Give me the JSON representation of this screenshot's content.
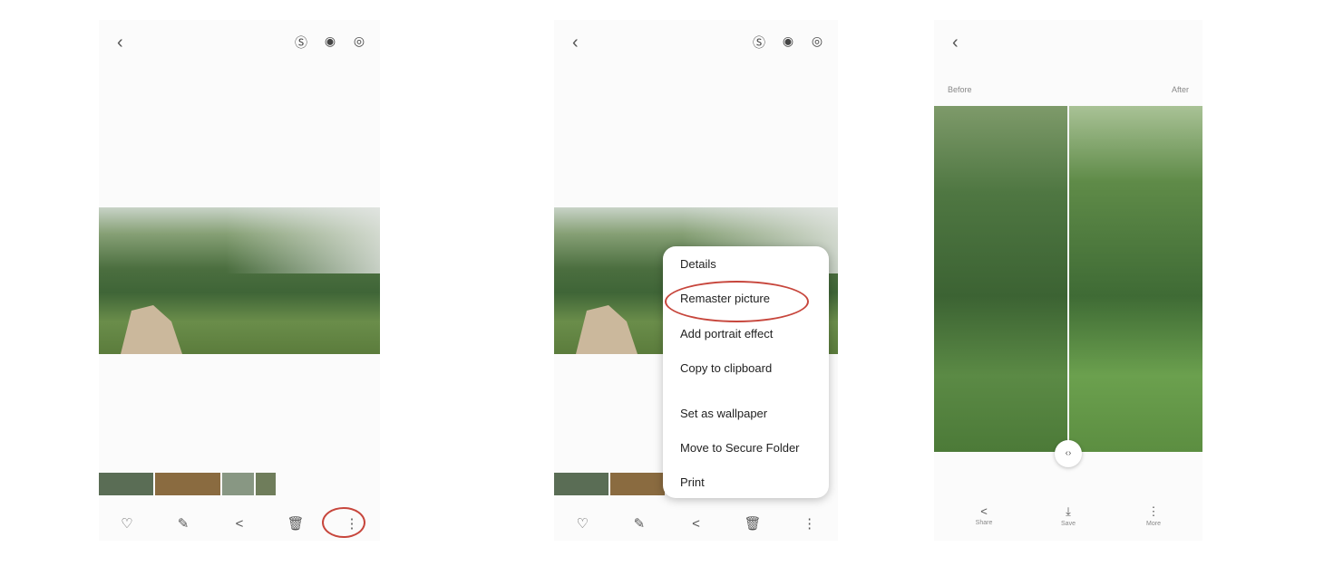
{
  "screen1": {
    "back_icon": "chevron-left-icon",
    "top_icons": [
      "bixby-vision-icon",
      "eye-icon",
      "live-focus-icon"
    ],
    "bottom_actions": [
      "heart-icon",
      "edit-icon",
      "share-icon",
      "delete-icon",
      "more-options-icon"
    ],
    "highlight_color": "#c7463c"
  },
  "screen2": {
    "menu_items": [
      "Details",
      "Remaster picture",
      "Add portrait effect",
      "Copy to clipboard",
      "Set as wallpaper",
      "Move to Secure Folder",
      "Print"
    ],
    "highlighted_item": "Remaster picture"
  },
  "screen3": {
    "before_label": "Before",
    "after_label": "After",
    "actions": [
      {
        "label": "Share",
        "icon": "share-icon"
      },
      {
        "label": "Save",
        "icon": "download-icon"
      },
      {
        "label": "More",
        "icon": "more-options-icon"
      }
    ]
  }
}
